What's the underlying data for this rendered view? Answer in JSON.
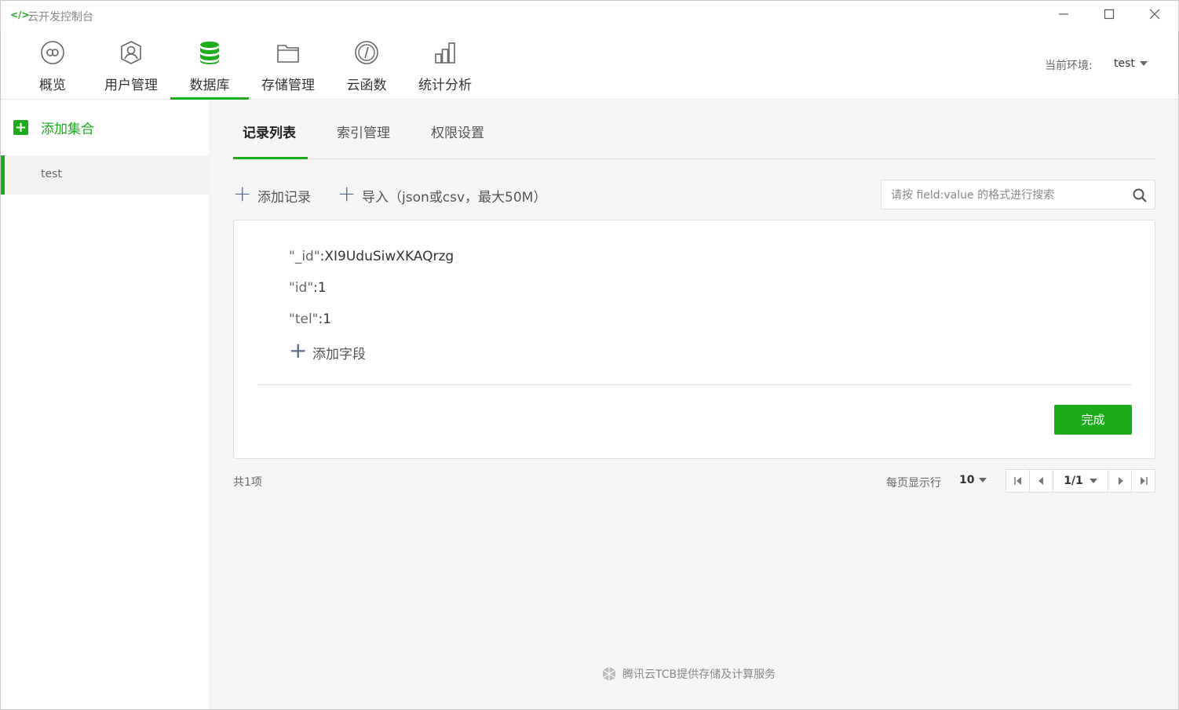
{
  "window": {
    "logo": "</>",
    "title": "云开发控制台"
  },
  "nav": {
    "items": [
      {
        "label": "概览",
        "icon": "overview-icon"
      },
      {
        "label": "用户管理",
        "icon": "user-icon"
      },
      {
        "label": "数据库",
        "icon": "database-icon"
      },
      {
        "label": "存储管理",
        "icon": "storage-icon"
      },
      {
        "label": "云函数",
        "icon": "cloud-function-icon"
      },
      {
        "label": "统计分析",
        "icon": "statistics-icon"
      }
    ],
    "active_index": 2,
    "env_label": "当前环境:",
    "env_value": "test"
  },
  "sidebar": {
    "add_label": "添加集合",
    "collections": [
      {
        "name": "test",
        "selected": true
      }
    ]
  },
  "tabs": [
    {
      "label": "记录列表",
      "active": true
    },
    {
      "label": "索引管理",
      "active": false
    },
    {
      "label": "权限设置",
      "active": false
    }
  ],
  "toolbar": {
    "add_record_label": "添加记录",
    "import_label": "导入（json或csv，最大50M）",
    "search_placeholder": "请按 field:value 的格式进行搜索"
  },
  "record": {
    "fields": [
      {
        "key": "\"_id\"",
        "value": "XI9UduSiwXKAQrzg"
      },
      {
        "key": "\"id\"",
        "value": "1"
      },
      {
        "key": "\"tel\"",
        "value": "1"
      }
    ],
    "add_field_label": "添加字段",
    "done_label": "完成"
  },
  "pagination": {
    "total_label": "共1项",
    "per_page_label": "每页显示行",
    "per_page_value": "10",
    "current_page": "1/1"
  },
  "footer": {
    "credit": "腾讯云TCB提供存储及计算服务"
  },
  "colors": {
    "accent": "#1aad19",
    "icon_gray": "#666666"
  }
}
